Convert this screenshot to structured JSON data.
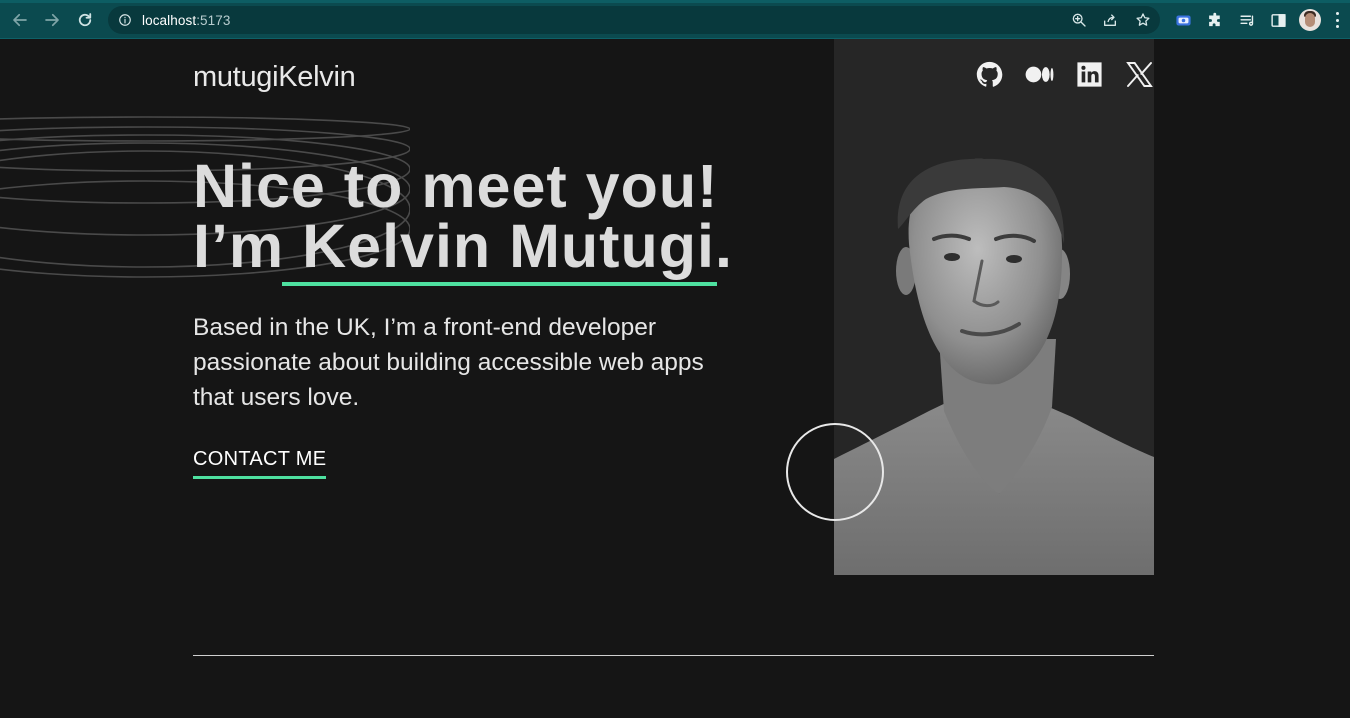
{
  "browser": {
    "url_host": "localhost",
    "url_port": ":5173",
    "colors": {
      "chrome": "#0b4a4f",
      "omnibox": "#08393d"
    },
    "icons": [
      "back-icon",
      "forward-icon",
      "reload-icon",
      "site-info-icon",
      "zoom-icon",
      "share-icon",
      "bookmark-star-icon",
      "screen-capture-extension-icon",
      "extensions-puzzle-icon",
      "reading-list-icon",
      "side-panel-icon",
      "profile-avatar",
      "more-menu-icon"
    ]
  },
  "site": {
    "brand": "mutugiKelvin",
    "hero": {
      "line1": "Nice to meet you!",
      "line2_prefix": "I’m ",
      "name": "Kelvin Mutugi",
      "line2_suffix": "."
    },
    "intro": "Based in the UK, I’m a front-end developer passionate about building accessible web apps that users love.",
    "cta": "CONTACT ME",
    "social": [
      "github-icon",
      "medium-icon",
      "linkedin-icon",
      "x-icon"
    ],
    "colors": {
      "background": "#151515",
      "accent": "#4ee1a0",
      "text": "#dcdcdc",
      "photo_panel": "#262626"
    }
  }
}
